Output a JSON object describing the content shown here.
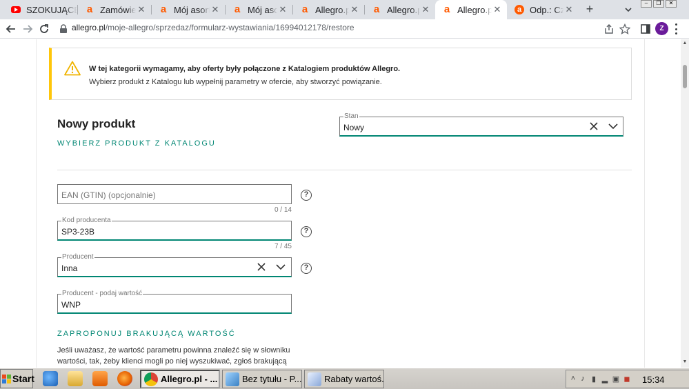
{
  "browser": {
    "tabs": [
      {
        "label": "SZOKUJĄCE",
        "favicon": "youtube-icon"
      },
      {
        "label": "Zamówienia",
        "favicon": "allegro-icon"
      },
      {
        "label": "Mój asortyment",
        "favicon": "allegro-icon"
      },
      {
        "label": "Mój asortyment",
        "favicon": "allegro-icon"
      },
      {
        "label": "Allegro.pl",
        "favicon": "allegro-icon"
      },
      {
        "label": "Allegro.pl",
        "favicon": "allegro-icon"
      },
      {
        "label": "Allegro.pl",
        "favicon": "allegro-icon",
        "active": true
      },
      {
        "label": "Odp.: Czy",
        "favicon": "allegro-community-icon"
      }
    ],
    "url_host": "allegro.pl",
    "url_path": "/moje-allegro/sprzedaz/formularz-wystawiania/16994012178/restore",
    "profile_initial": "Z"
  },
  "alert": {
    "title": "W tej kategorii wymagamy, aby oferty były połączone z Katalogiem produktów Allegro.",
    "text": "Wybierz produkt z Katalogu lub wypełnij parametry w ofercie, aby stworzyć powiązanie."
  },
  "product": {
    "title": "Nowy produkt",
    "catalog_link": "WYBIERZ PRODUKT Z KATALOGU",
    "condition": {
      "legend": "Stan",
      "value": "Nowy"
    }
  },
  "fields": {
    "ean": {
      "placeholder": "EAN (GTIN) (opcjonalnie)",
      "counter": "0 / 14"
    },
    "producer_code": {
      "legend": "Kod producenta",
      "value": "SP3-23B",
      "counter": "7 / 45"
    },
    "producer": {
      "legend": "Producent",
      "value": "Inna"
    },
    "producer_value": {
      "legend": "Producent - podaj wartość",
      "value": "WNP"
    }
  },
  "suggest": {
    "link": "ZAPROPONUJ BRAKUJĄCĄ WARTOŚĆ",
    "text": "Jeśli uważasz, że wartość parametru powinna znaleźć się w słowniku wartości, tak, żeby klienci mogli po niej wyszukiwać, zgłoś brakującą"
  },
  "help_glyph": "?",
  "taskbar": {
    "start_label": "Start",
    "tasks": [
      {
        "label": "Allegro.pl - ...",
        "active": true
      },
      {
        "label": "Bez tytułu - P..."
      },
      {
        "label": "Rabaty wartoś..."
      }
    ],
    "clock": "15:34"
  },
  "colors": {
    "accent": "#008673",
    "warning": "#ffc60a",
    "allegro": "#ff5a00"
  }
}
